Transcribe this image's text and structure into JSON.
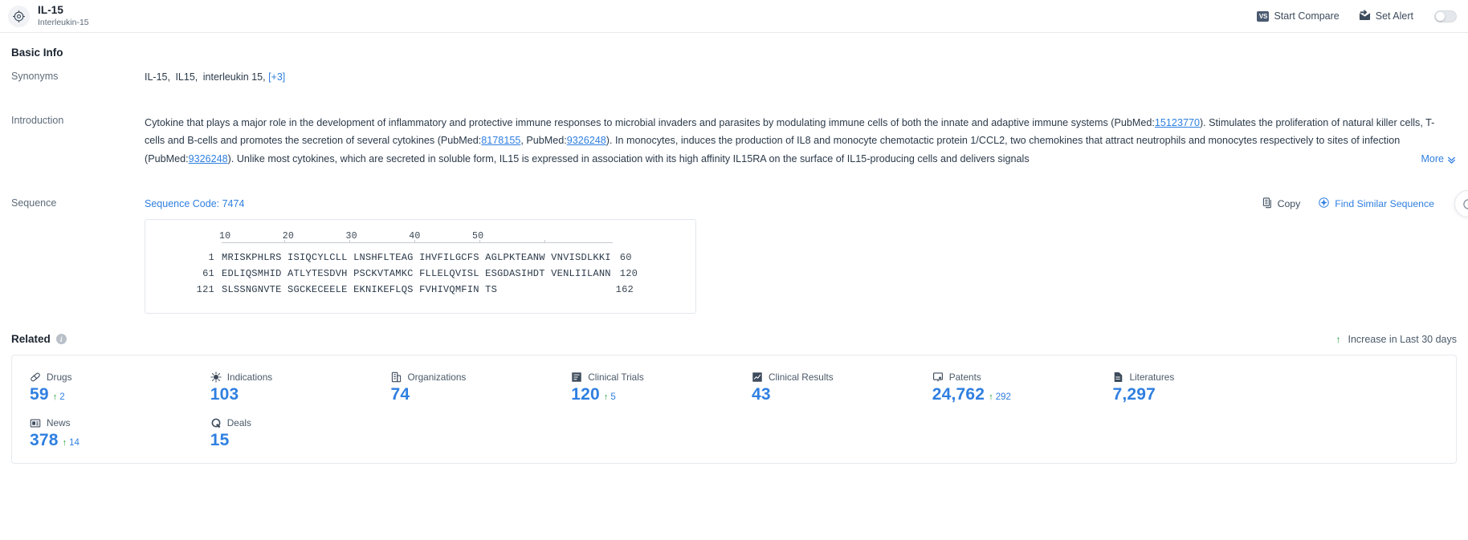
{
  "header": {
    "icon": "target-crosshair-icon",
    "title": "IL-15",
    "subtitle": "Interleukin-15",
    "start_compare_label": "Start Compare",
    "start_compare_badge": "VS",
    "set_alert_label": "Set Alert",
    "alert_toggle_state": "off"
  },
  "basic_info": {
    "heading": "Basic Info",
    "synonyms": {
      "label": "Synonyms",
      "values": [
        "IL-15,",
        "IL15,",
        "interleukin 15,"
      ],
      "more_label": "[+3]"
    },
    "introduction": {
      "label": "Introduction",
      "seg1": "Cytokine that plays a major role in the development of inflammatory and protective immune responses to microbial invaders and parasites by modulating immune cells of both the innate and adaptive immune systems (PubMed:",
      "pm1": "15123770",
      "seg2": "). Stimulates the proliferation of natural killer cells, T-cells and B-cells and promotes the secretion of several cytokines (PubMed:",
      "pm2": "8178155",
      "seg3": ", PubMed:",
      "pm3": "9326248",
      "seg4": "). In monocytes, induces the production of IL8 and monocyte chemotactic protein 1/CCL2, two chemokines that attract neutrophils and monocytes respectively to sites of infection (PubMed:",
      "pm4": "9326248",
      "seg5": "). Unlike most cytokines, which are secreted in soluble form, IL15 is expressed in association with its high affinity IL15RA on the surface of IL15-producing cells and delivers signals",
      "more_label": "More"
    },
    "sequence": {
      "label": "Sequence",
      "code_label": "Sequence Code: 7474",
      "copy_label": "Copy",
      "find_similar_label": "Find Similar Sequence",
      "ruler_ticks": [
        "10",
        "20",
        "30",
        "40",
        "50"
      ],
      "lines": [
        {
          "start": "1",
          "chunks": "MRISKPHLRS ISIQCYLCLL LNSHFLTEAG IHVFILGCFS AGLPKTEANW VNVISDLKKI",
          "end": "60"
        },
        {
          "start": "61",
          "chunks": "EDLIQSMHID ATLYTESDVH PSCKVTAMKC FLLELQVISL ESGDASIHDT VENLIILANN",
          "end": "120"
        },
        {
          "start": "121",
          "chunks": "SLSSNGNVTE SGCKECEELE EKNIKEFLQS FVHIVQMFIN TS",
          "end": "162"
        }
      ]
    }
  },
  "related": {
    "heading": "Related",
    "info_glyph": "i",
    "increase_note": "Increase in Last 30 days",
    "increase_arrow": "↑",
    "stats": [
      {
        "icon": "pill-capsule-icon",
        "label": "Drugs",
        "value": "59",
        "delta": "2"
      },
      {
        "icon": "virus-icon",
        "label": "Indications",
        "value": "103",
        "delta": ""
      },
      {
        "icon": "building-icon",
        "label": "Organizations",
        "value": "74",
        "delta": ""
      },
      {
        "icon": "clinical-trial-icon",
        "label": "Clinical Trials",
        "value": "120",
        "delta": "5"
      },
      {
        "icon": "clinical-result-icon",
        "label": "Clinical Results",
        "value": "43",
        "delta": ""
      },
      {
        "icon": "patent-icon",
        "label": "Patents",
        "value": "24,762",
        "delta": "292"
      },
      {
        "icon": "literature-icon",
        "label": "Literatures",
        "value": "7,297",
        "delta": ""
      },
      {
        "icon": "news-icon",
        "label": "News",
        "value": "378",
        "delta": "14"
      },
      {
        "icon": "deals-icon",
        "label": "Deals",
        "value": "15",
        "delta": ""
      }
    ]
  },
  "colors": {
    "accent_blue": "#2f7fe0",
    "up_green": "#22a03c",
    "text_dark": "#2b3a4a",
    "text_muted": "#5d6b7a",
    "border": "#e6eaee"
  }
}
